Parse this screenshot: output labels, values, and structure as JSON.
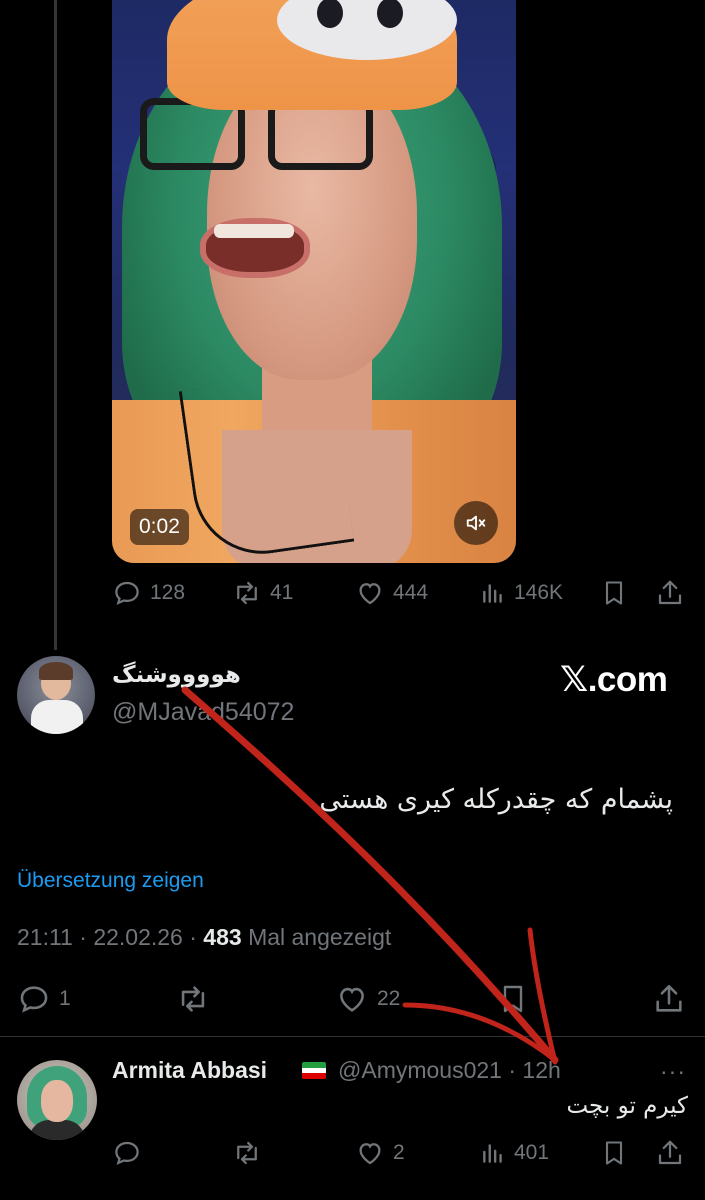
{
  "video": {
    "time": "0:02",
    "mute_icon": "volume-mute-icon"
  },
  "tweet1_actions": {
    "replies": "128",
    "reposts": "41",
    "likes": "444",
    "views": "146K"
  },
  "tweet2": {
    "display_name": "هووووشنگ",
    "handle": "@MJavad54072",
    "text": "پشمام که چقدرکله کیری هستی",
    "translate_link": "Übersetzung zeigen",
    "time": "21:11",
    "date": "22.02.26",
    "views_count": "483",
    "views_label": "Mal angezeigt",
    "actions": {
      "replies": "1",
      "likes": "22"
    }
  },
  "watermark": "𝕏.com",
  "tweet3": {
    "display_name": "Armita Abbasi",
    "handle": "@Amymous021",
    "age": "12h",
    "more": "···",
    "text": "کیرم تو بچت",
    "actions": {
      "likes": "2",
      "views": "401"
    }
  },
  "colors": {
    "background": "#000000",
    "muted": "#71767b",
    "link": "#1d9bf0",
    "annotation_arrow": "#c0241a"
  }
}
